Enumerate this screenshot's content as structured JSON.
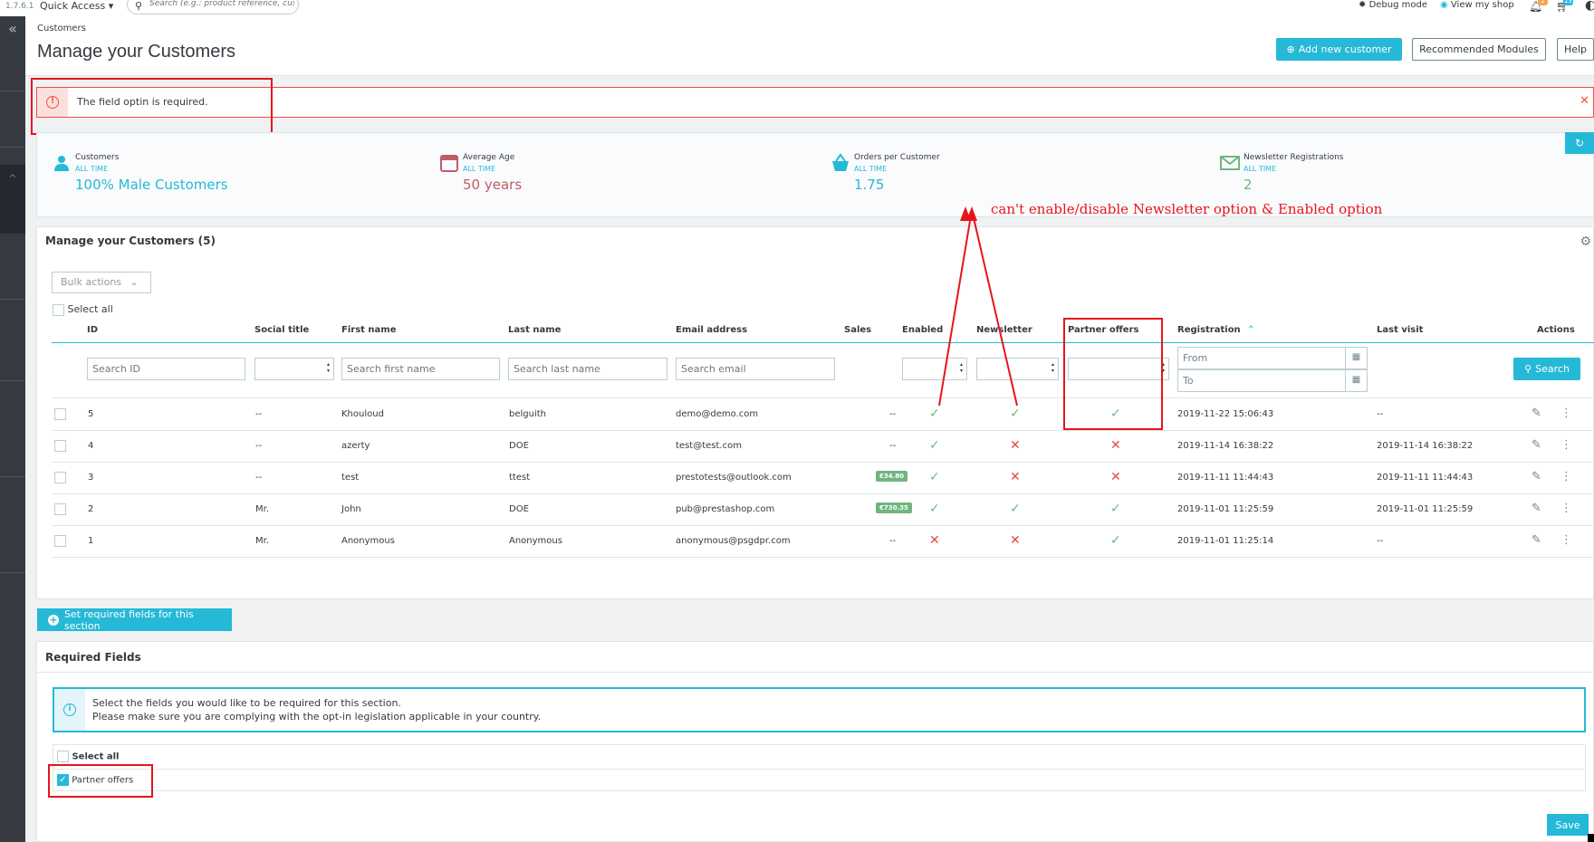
{
  "topbar": {
    "version": "1.7.6.1",
    "quick_access": "Quick Access",
    "search_placeholder": "Search (e.g.: product reference, customer",
    "debug_mode": "Debug mode",
    "view_shop": "View my shop",
    "notif_count": "2",
    "cart_count": "13"
  },
  "header": {
    "breadcrumb": "Customers",
    "title": "Manage your Customers",
    "add_button": "Add new customer",
    "modules_button": "Recommended Modules",
    "help_button": "Help"
  },
  "alert": {
    "message": "The field optin is required."
  },
  "kpis": [
    {
      "title": "Customers",
      "period": "ALL TIME",
      "value": "100% Male Customers",
      "color": "#25b9d7",
      "icon": "user-icon"
    },
    {
      "title": "Average Age",
      "period": "ALL TIME",
      "value": "50 years",
      "color": "#c05c67",
      "icon": "calendar-icon"
    },
    {
      "title": "Orders per Customer",
      "period": "ALL TIME",
      "value": "1.75",
      "color": "#25b9d7",
      "icon": "basket-icon"
    },
    {
      "title": "Newsletter Registrations",
      "period": "ALL TIME",
      "value": "2",
      "color": "#70b580",
      "icon": "envelope-icon"
    }
  ],
  "annotation": "can't enable/disable Newsletter option & Enabled option",
  "list": {
    "title": "Manage your Customers (5)",
    "bulk_actions": "Bulk actions",
    "select_all": "Select all",
    "columns": {
      "id": "ID",
      "social": "Social title",
      "first": "First name",
      "last": "Last name",
      "email": "Email address",
      "sales": "Sales",
      "enabled": "Enabled",
      "newsletter": "Newsletter",
      "partner": "Partner offers",
      "registration": "Registration",
      "last_visit": "Last visit",
      "actions": "Actions"
    },
    "filters": {
      "id": "Search ID",
      "first": "Search first name",
      "last": "Search last name",
      "email": "Search email",
      "from": "From",
      "to": "To",
      "search_button": "Search"
    },
    "rows": [
      {
        "id": "5",
        "social": "--",
        "first": "Khouloud",
        "last": "belguith",
        "email": "demo@demo.com",
        "sales": "--",
        "sales_badge": false,
        "enabled": true,
        "newsletter": true,
        "partner": true,
        "registration": "2019-11-22 15:06:43",
        "last_visit": "--"
      },
      {
        "id": "4",
        "social": "--",
        "first": "azerty",
        "last": "DOE",
        "email": "test@test.com",
        "sales": "--",
        "sales_badge": false,
        "enabled": true,
        "newsletter": false,
        "partner": false,
        "registration": "2019-11-14 16:38:22",
        "last_visit": "2019-11-14 16:38:22"
      },
      {
        "id": "3",
        "social": "--",
        "first": "test",
        "last": "ttest",
        "email": "prestotests@outlook.com",
        "sales": "€34.80",
        "sales_badge": true,
        "enabled": true,
        "newsletter": false,
        "partner": false,
        "registration": "2019-11-11 11:44:43",
        "last_visit": "2019-11-11 11:44:43"
      },
      {
        "id": "2",
        "social": "Mr.",
        "first": "John",
        "last": "DOE",
        "email": "pub@prestashop.com",
        "sales": "€730.35",
        "sales_badge": true,
        "enabled": true,
        "newsletter": true,
        "partner": true,
        "registration": "2019-11-01 11:25:59",
        "last_visit": "2019-11-01 11:25:59"
      },
      {
        "id": "1",
        "social": "Mr.",
        "first": "Anonymous",
        "last": "Anonymous",
        "email": "anonymous@psgdpr.com",
        "sales": "--",
        "sales_badge": false,
        "enabled": false,
        "newsletter": false,
        "partner": true,
        "registration": "2019-11-01 11:25:14",
        "last_visit": "--"
      }
    ]
  },
  "required": {
    "set_button": "Set required fields for this section",
    "title": "Required Fields",
    "info_line1": "Select the fields you would like to be required for this section.",
    "info_line2": "Please make sure you are complying with the opt-in legislation applicable in your country.",
    "select_all": "Select all",
    "partner_offers": "Partner offers",
    "save": "Save"
  }
}
